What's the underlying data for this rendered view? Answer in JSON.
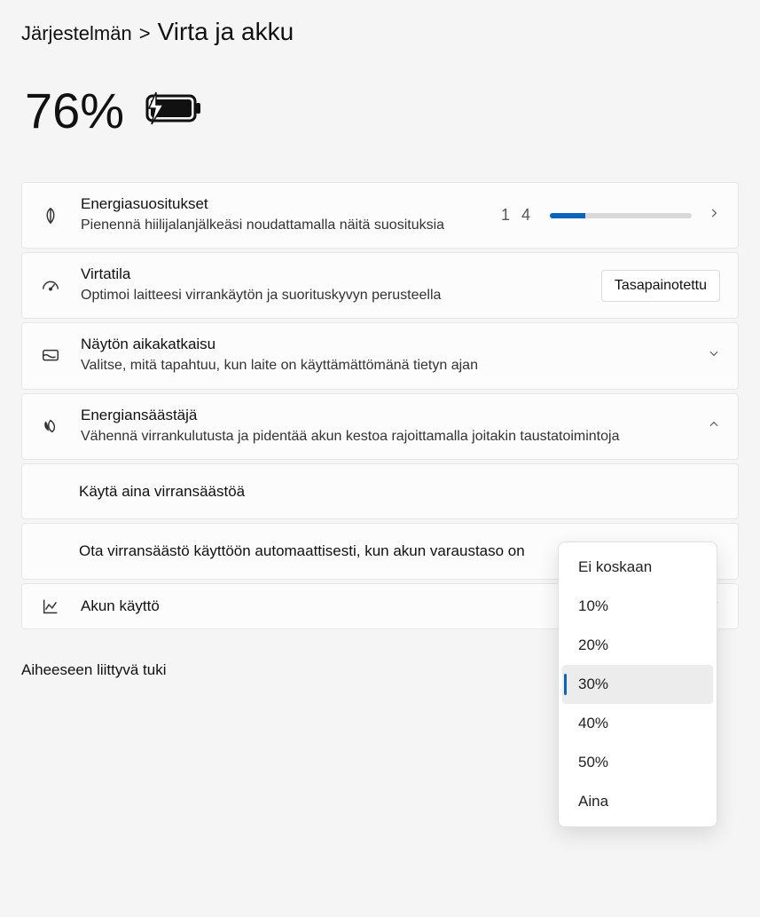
{
  "breadcrumb": {
    "parent": "Järjestelmän",
    "separator": ">",
    "current": "Virta ja akku"
  },
  "battery": {
    "percent": "76%"
  },
  "energyRec": {
    "title": "Energiasuositukset",
    "sub": "Pienennä hiilijalanjälkeäsi noudattamalla näitä suosituksia",
    "count": "1 4",
    "progress_pct": 25
  },
  "powerMode": {
    "title": "Virtatila",
    "sub": "Optimoi laitteesi virrankäytön ja suorituskyvyn perusteella",
    "value": "Tasapainotettu"
  },
  "screenTimeout": {
    "title": "Näytön aikakatkaisu",
    "sub": "Valitse, mitä tapahtuu, kun laite on käyttämättömänä tietyn ajan"
  },
  "energySaver": {
    "title": "Energiansäästäjä",
    "sub": "Vähennä virrankulutusta ja pidentää akun kestoa rajoittamalla joitakin taustatoimintoja",
    "alwaysUse": "Käytä aina virransäästöä",
    "autoOn": "Ota virransäästö käyttöön automaattisesti, kun akun varaustaso on"
  },
  "dropdown": {
    "options": [
      {
        "label": "Ei koskaan"
      },
      {
        "label": "10%"
      },
      {
        "label": "20%"
      },
      {
        "label": "30%"
      },
      {
        "label": "40%"
      },
      {
        "label": "50%"
      },
      {
        "label": "Aina"
      }
    ],
    "selected_index": 3
  },
  "batteryUsage": {
    "title": "Akun käyttö"
  },
  "footer": {
    "title": "Aiheeseen liittyvä tuki"
  }
}
